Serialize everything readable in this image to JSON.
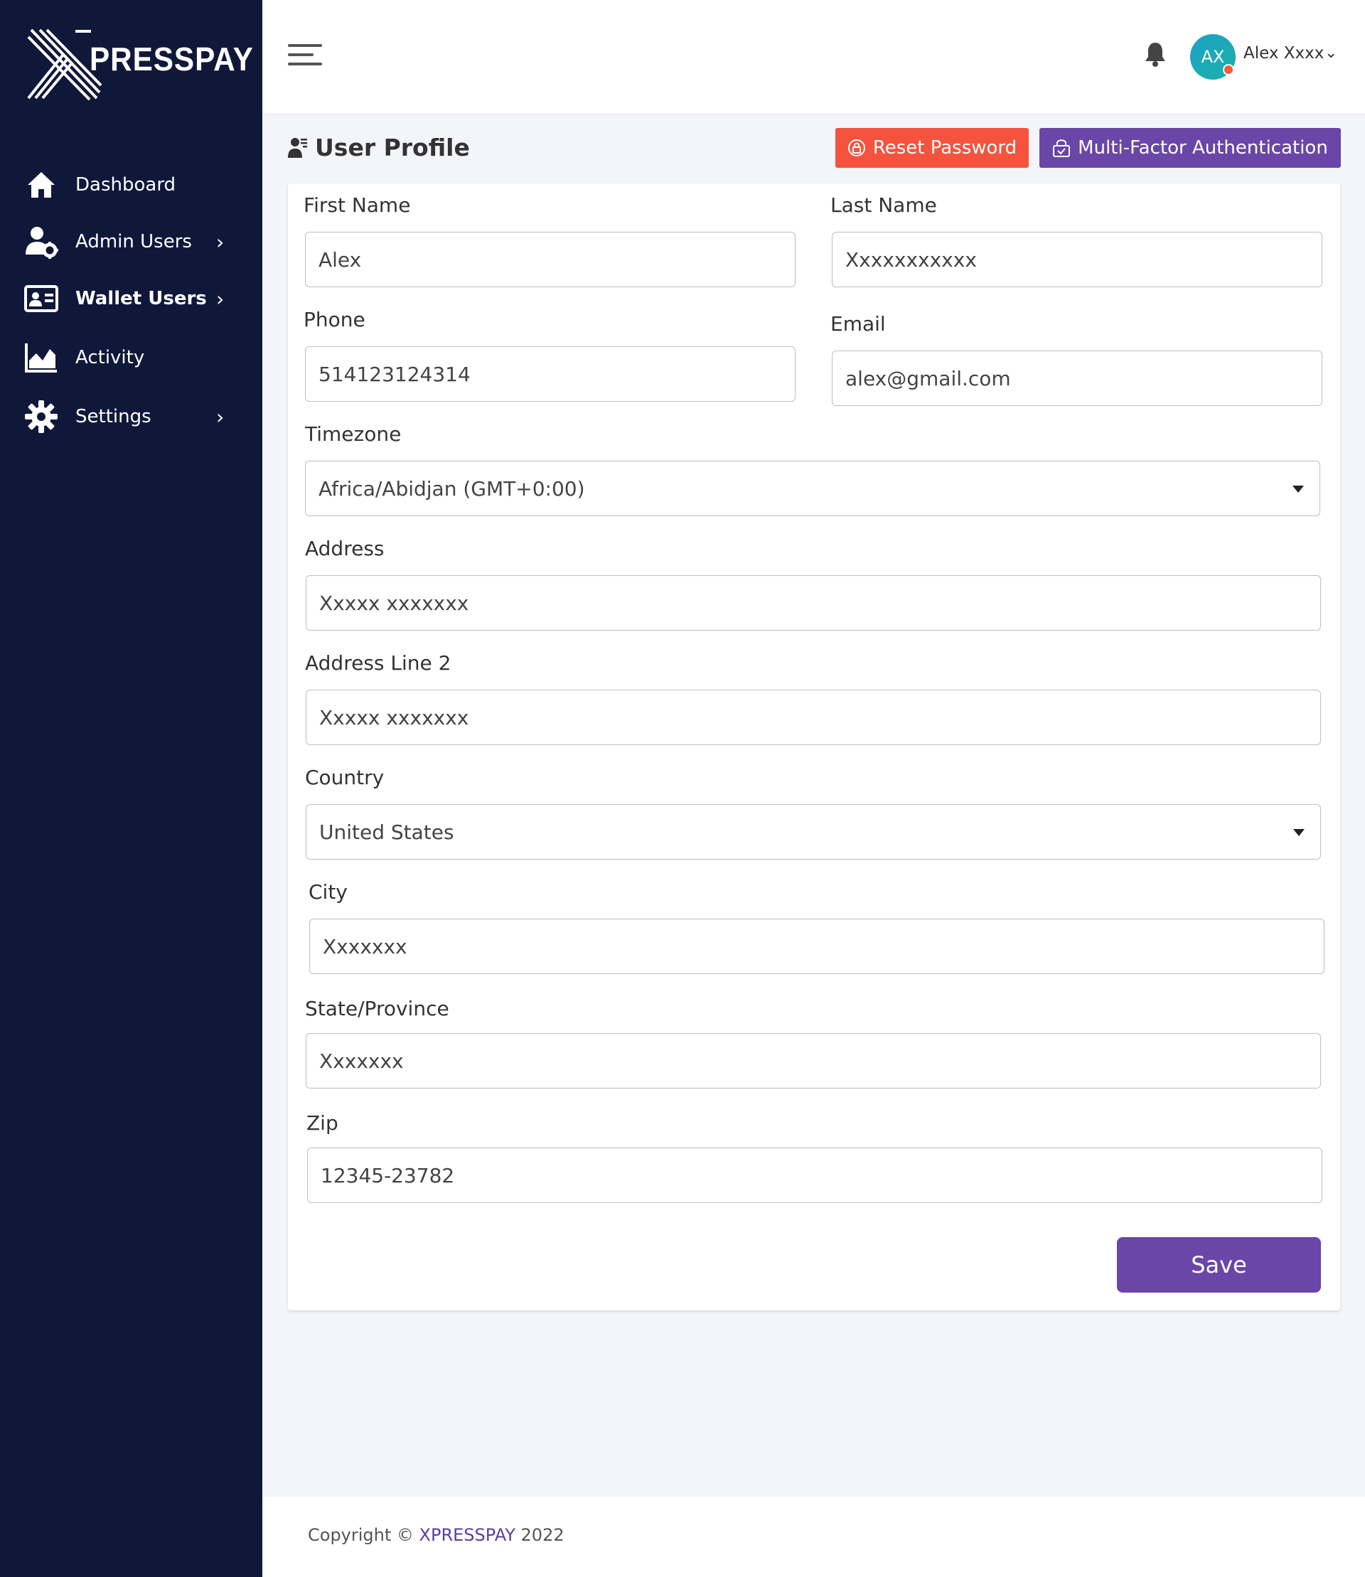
{
  "brand": {
    "logo_text": "PRESSPAY"
  },
  "sidebar": {
    "items": [
      {
        "label": "Dashboard",
        "icon": "home-icon",
        "has_children": false
      },
      {
        "label": "Admin Users",
        "icon": "user-cog-icon",
        "has_children": true
      },
      {
        "label": "Wallet Users",
        "icon": "id-card-icon",
        "has_children": true,
        "active": true
      },
      {
        "label": "Activity",
        "icon": "area-chart-icon",
        "has_children": false
      },
      {
        "label": "Settings",
        "icon": "gear-icon",
        "has_children": true
      }
    ]
  },
  "header": {
    "menu_icon": "hamburger-icon",
    "notifications_icon": "bell-icon",
    "user_initials": "AX",
    "user_name": "Alex Xxxx",
    "avatar_color": "#1ea0c6",
    "status_dot_color": "#f25c3b"
  },
  "page": {
    "title": "User Profile",
    "title_icon": "user-profile-icon",
    "reset_password_label": "Reset Password",
    "reset_password_color": "#f5533d",
    "mfa_label": "Multi-Factor Authentication",
    "mfa_color": "#6a46a8"
  },
  "form": {
    "first_name": {
      "label": "First Name",
      "value": "Alex"
    },
    "last_name": {
      "label": "Last Name",
      "value": "Xxxxxxxxxxx"
    },
    "phone": {
      "label": "Phone",
      "value": "514123124314"
    },
    "email": {
      "label": "Email",
      "value": "alex@gmail.com"
    },
    "timezone": {
      "label": "Timezone",
      "value": "Africa/Abidjan (GMT+0:00)"
    },
    "address": {
      "label": "Address",
      "value": "Xxxxx xxxxxxx"
    },
    "address2": {
      "label": "Address Line 2",
      "value": "Xxxxx xxxxxxx"
    },
    "country": {
      "label": "Country",
      "value": "United States"
    },
    "city": {
      "label": "City",
      "value": "Xxxxxxx"
    },
    "state": {
      "label": "State/Province",
      "value": "Xxxxxxx"
    },
    "zip": {
      "label": "Zip",
      "value": "12345-23782"
    },
    "save_label": "Save"
  },
  "footer": {
    "prefix": "Copyright © ",
    "brand": "XPRESSPAY",
    "year": " 2022"
  }
}
